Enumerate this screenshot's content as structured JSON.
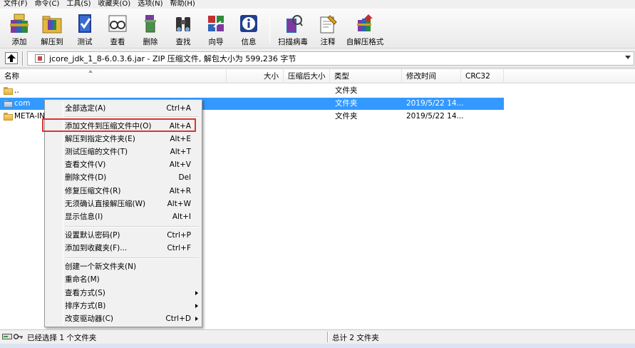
{
  "menubar": [
    "文件(F)",
    "命令(C)",
    "工具(S)",
    "收藏夹(O)",
    "选项(N)",
    "帮助(H)"
  ],
  "toolbar": [
    {
      "label": "添加",
      "icon": "add-books-icon"
    },
    {
      "label": "解压到",
      "icon": "extract-folder-icon"
    },
    {
      "label": "测试",
      "icon": "test-check-icon"
    },
    {
      "label": "查看",
      "icon": "view-glasses-icon"
    },
    {
      "label": "删除",
      "icon": "delete-trash-icon"
    },
    {
      "label": "查找",
      "icon": "find-binoculars-icon"
    },
    {
      "label": "向导",
      "icon": "wizard-icon"
    },
    {
      "label": "信息",
      "icon": "info-icon"
    },
    {
      "label": "扫描病毒",
      "icon": "scan-virus-icon"
    },
    {
      "label": "注释",
      "icon": "comment-icon"
    },
    {
      "label": "自解压格式",
      "icon": "sfx-icon"
    }
  ],
  "address": {
    "path": "jcore_jdk_1_8-6.0.3.6.jar - ZIP 压缩文件, 解包大小为 599,236 字节"
  },
  "columns": [
    "名称",
    "大小",
    "压缩后大小",
    "类型",
    "修改时间",
    "CRC32"
  ],
  "rows": [
    {
      "name": "..",
      "size": "",
      "packed": "",
      "type": "文件夹",
      "modified": "",
      "crc": ""
    },
    {
      "name": "com",
      "size": "",
      "packed": "",
      "type": "文件夹",
      "modified": "2019/5/22 14...",
      "crc": ""
    },
    {
      "name": "META-IN",
      "size": "",
      "packed": "",
      "type": "文件夹",
      "modified": "2019/5/22 14...",
      "crc": ""
    }
  ],
  "context_menu": {
    "items": [
      {
        "label": "全部选定(A)",
        "key": "Ctrl+A"
      },
      {
        "label": "添加文件到压缩文件中(O)",
        "key": "Alt+A"
      },
      {
        "label": "解压到指定文件夹(E)",
        "key": "Alt+E"
      },
      {
        "label": "测试压缩的文件(T)",
        "key": "Alt+T"
      },
      {
        "label": "查看文件(V)",
        "key": "Alt+V"
      },
      {
        "label": "删除文件(D)",
        "key": "Del"
      },
      {
        "label": "修复压缩文件(R)",
        "key": "Alt+R"
      },
      {
        "label": "无须确认直接解压缩(W)",
        "key": "Alt+W"
      },
      {
        "label": "显示信息(I)",
        "key": "Alt+I"
      },
      {
        "label": "设置默认密码(P)",
        "key": "Ctrl+P"
      },
      {
        "label": "添加到收藏夹(F)...",
        "key": "Ctrl+F"
      },
      {
        "label": "创建一个新文件夹(N)",
        "key": ""
      },
      {
        "label": "重命名(M)",
        "key": ""
      },
      {
        "label": "查看方式(S)",
        "key": ""
      },
      {
        "label": "排序方式(B)",
        "key": ""
      },
      {
        "label": "改变驱动器(C)",
        "key": "Ctrl+D"
      }
    ]
  },
  "status": {
    "left": "已经选择 1 个文件夹",
    "right": "总计 2 文件夹"
  }
}
